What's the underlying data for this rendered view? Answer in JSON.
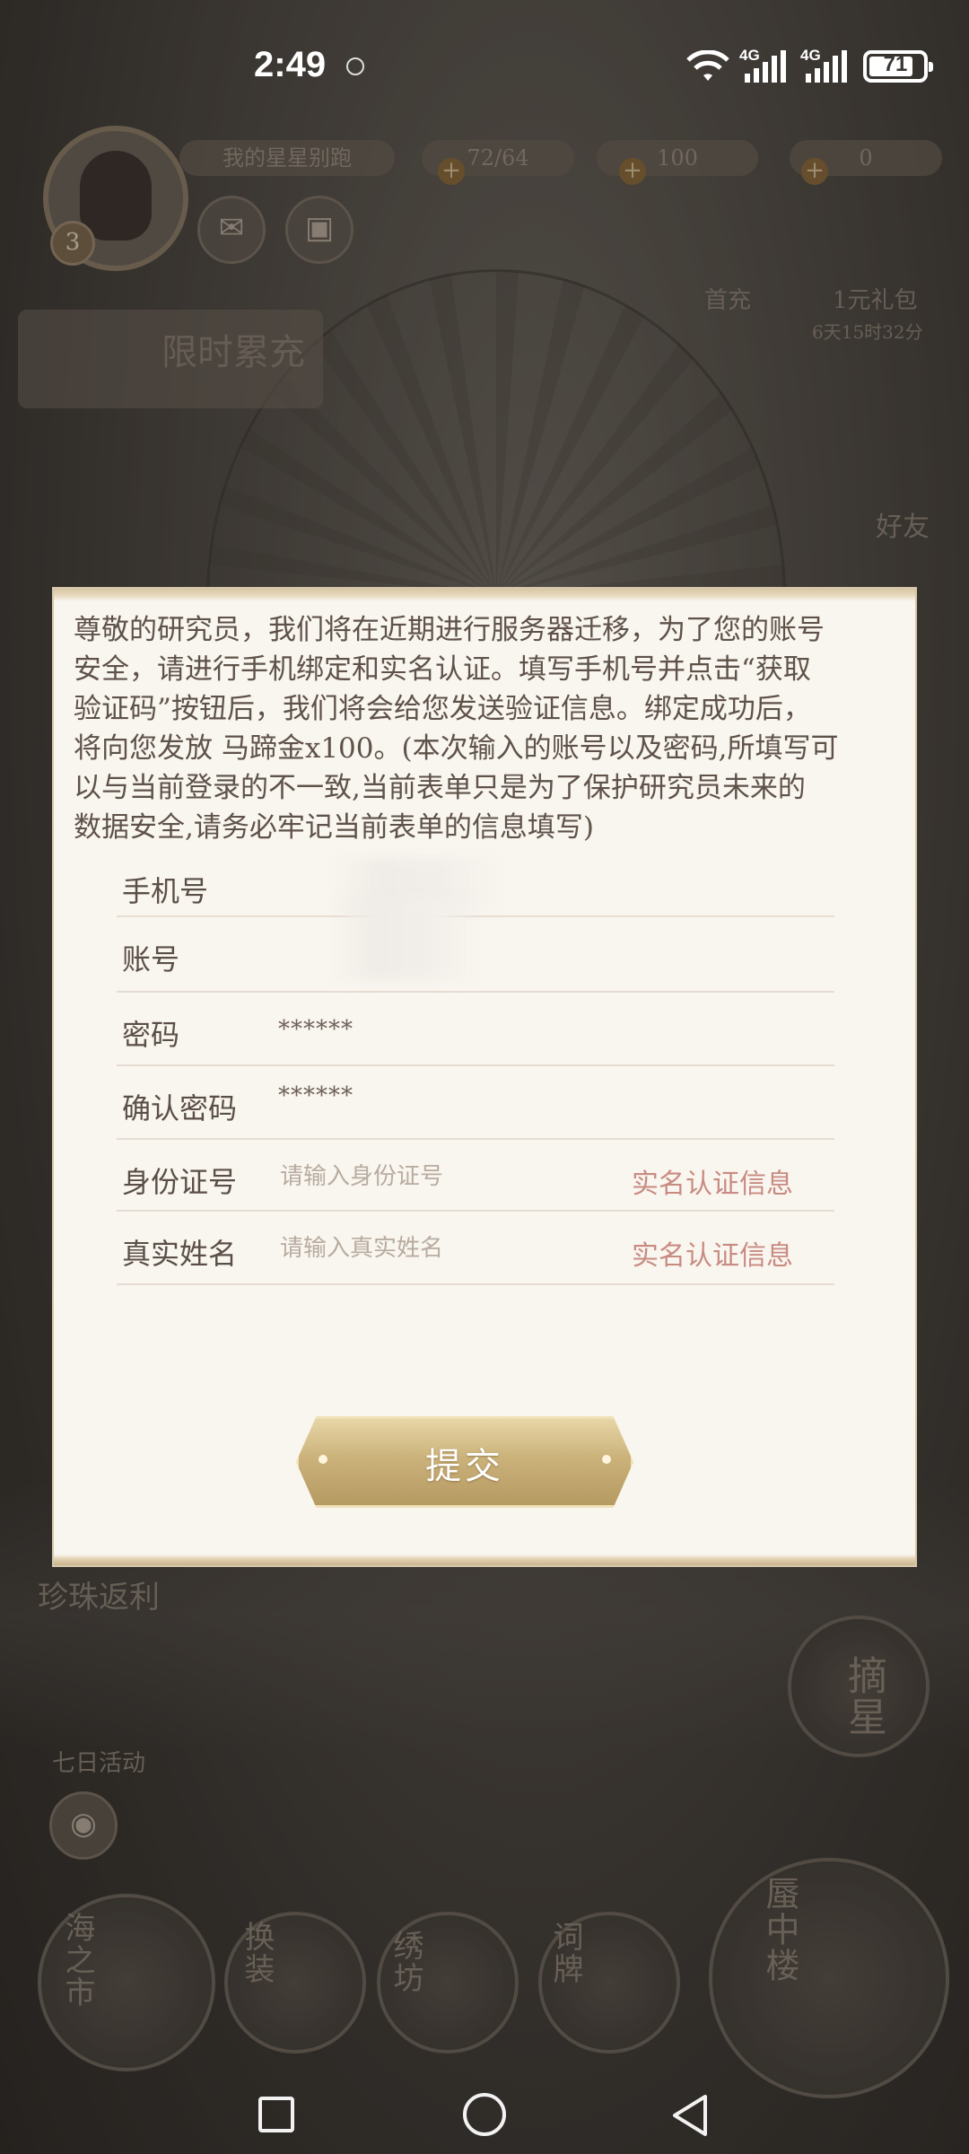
{
  "status_bar": {
    "time": "2:49",
    "signal_1": "4G",
    "signal_2": "4G",
    "battery": "71"
  },
  "game_hud": {
    "player_name": "我的星星别跑",
    "player_level": "3",
    "stamina": "72/64",
    "gold": "100",
    "gems": "0",
    "first_charge": "首充",
    "gift_pack": "1元礼包",
    "gift_timer": "6天15时32分",
    "friends": "好友",
    "limited_recharge": "限时累充",
    "pearl_rebate": "珍珠返利",
    "seven_day": "七日活动",
    "pick_star": "摘星",
    "bottom_menu": [
      "海之市",
      "换装",
      "绣坊",
      "词牌",
      "蜃中楼"
    ]
  },
  "dialog": {
    "notice": "尊敬的研究员，我们将在近期进行服务器迁移，为了您的账号\n安全，请进行手机绑定和实名认证。填写手机号并点击“获取\n验证码”按钮后，我们将会给您发送验证信息。绑定成功后，\n将向您发放 马蹄金x100。(本次输入的账号以及密码,所填写可\n以与当前登录的不一致,当前表单只是为了保护研究员未来的\n数据安全,请务必牢记当前表单的信息填写)",
    "fields": {
      "phone": {
        "label": "手机号",
        "value": ""
      },
      "account": {
        "label": "账号",
        "value": ""
      },
      "password": {
        "label": "密码",
        "value": "******"
      },
      "confirm_password": {
        "label": "确认密码",
        "value": "******"
      },
      "id_number": {
        "label": "身份证号",
        "placeholder": "请输入身份证号",
        "hint": "实名认证信息"
      },
      "real_name": {
        "label": "真实姓名",
        "placeholder": "请输入真实姓名",
        "hint": "实名认证信息"
      }
    },
    "submit_label": "提交"
  },
  "colors": {
    "dialog_bg": "#f9f5ef",
    "hint_red": "#c88b82",
    "gold_button": "#cbb27a"
  }
}
